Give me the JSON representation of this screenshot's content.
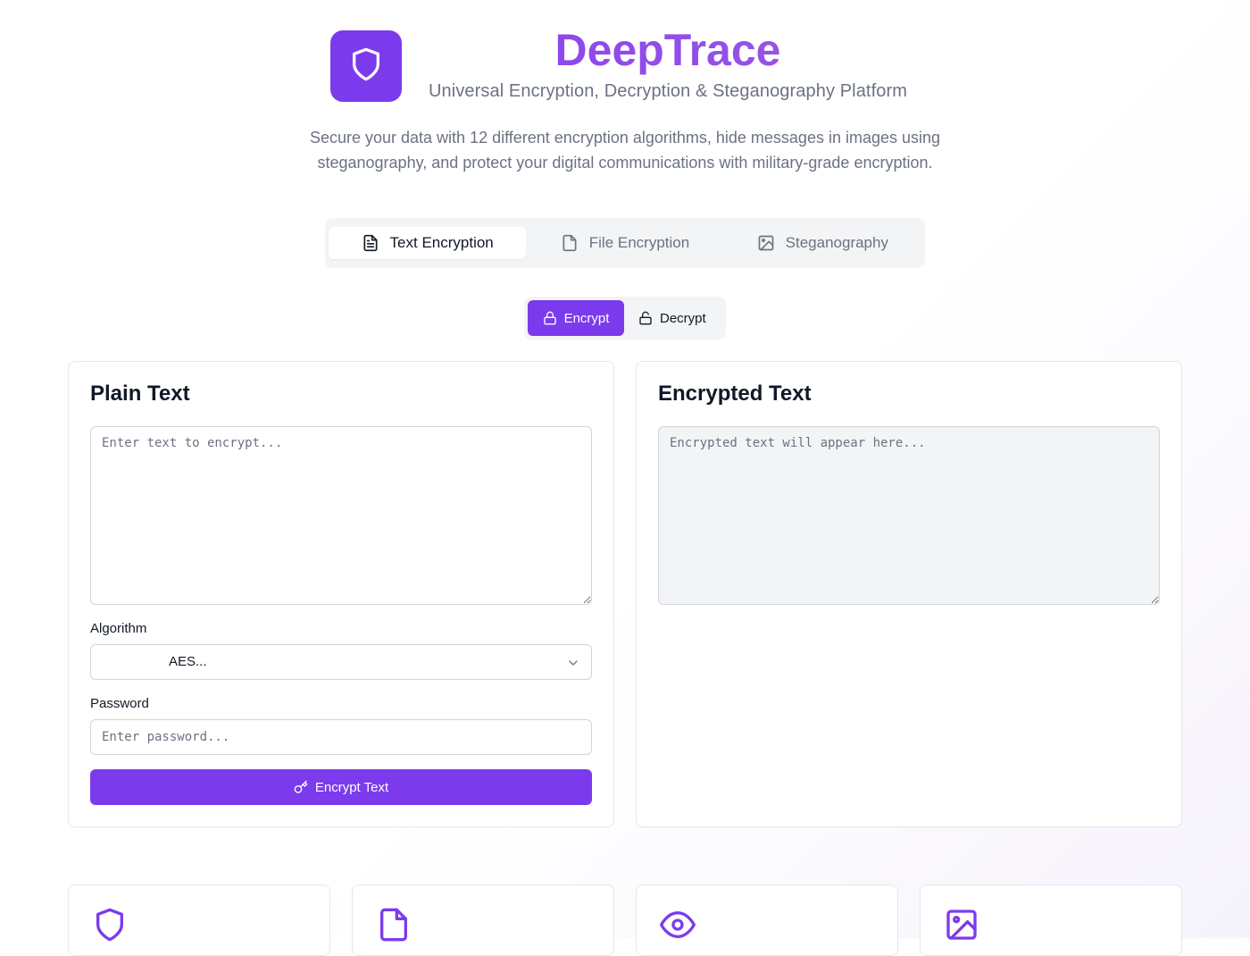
{
  "app": {
    "title": "DeepTrace",
    "subtitle": "Universal Encryption, Decryption & Steganography Platform",
    "description": "Secure your data with 12 different encryption algorithms, hide messages in images using steganography, and protect your digital communications with military-grade encryption.",
    "logo_icon": "shield-icon",
    "accent_color": "#7c3aed"
  },
  "tabs": [
    {
      "label": "Text Encryption",
      "icon": "file-text-icon",
      "active": true
    },
    {
      "label": "File Encryption",
      "icon": "file-icon",
      "active": false
    },
    {
      "label": "Steganography",
      "icon": "image-icon",
      "active": false
    }
  ],
  "modes": [
    {
      "label": "Encrypt",
      "icon": "lock-icon",
      "active": true
    },
    {
      "label": "Decrypt",
      "icon": "unlock-icon",
      "active": false
    }
  ],
  "plain_panel": {
    "title": "Plain Text",
    "input_placeholder": "Enter text to encrypt...",
    "input_value": "",
    "algorithm_label": "Algorithm",
    "algorithm_value": "AES...",
    "password_label": "Password",
    "password_placeholder": "Enter password...",
    "submit_label": "Encrypt Text",
    "submit_icon": "key-icon"
  },
  "encrypted_panel": {
    "title": "Encrypted Text",
    "output_placeholder": "Encrypted text will appear here...",
    "output_value": ""
  },
  "features": [
    {
      "icon": "shield-icon"
    },
    {
      "icon": "file-icon"
    },
    {
      "icon": "eye-icon"
    },
    {
      "icon": "image-icon"
    }
  ]
}
